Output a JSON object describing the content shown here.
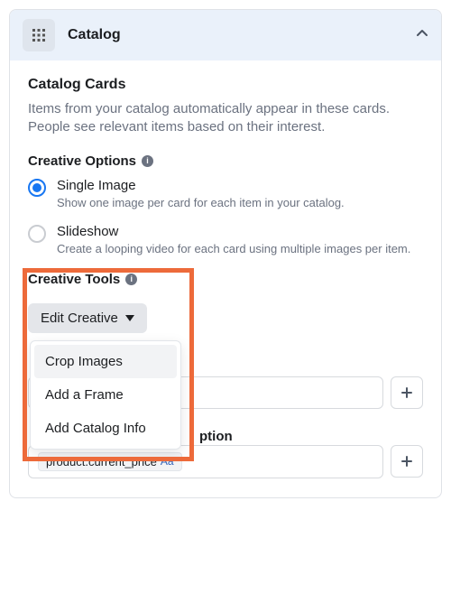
{
  "panel": {
    "title": "Catalog"
  },
  "cards": {
    "title": "Catalog Cards",
    "description": "Items from your catalog automatically appear in these cards. People see relevant items based on their interest."
  },
  "creative_options": {
    "heading": "Creative Options",
    "options": [
      {
        "label": "Single Image",
        "desc": "Show one image per card for each item in your catalog.",
        "selected": true
      },
      {
        "label": "Slideshow",
        "desc": "Create a looping video for each card using multiple images per item.",
        "selected": false
      }
    ]
  },
  "creative_tools": {
    "heading": "Creative Tools",
    "button_label": "Edit Creative",
    "menu": [
      "Crop Images",
      "Add a Frame",
      "Add Catalog Info"
    ]
  },
  "fields": {
    "partial_label": "ption",
    "price_chip": "product.current_price",
    "price_chip_suffix": "Aa"
  }
}
